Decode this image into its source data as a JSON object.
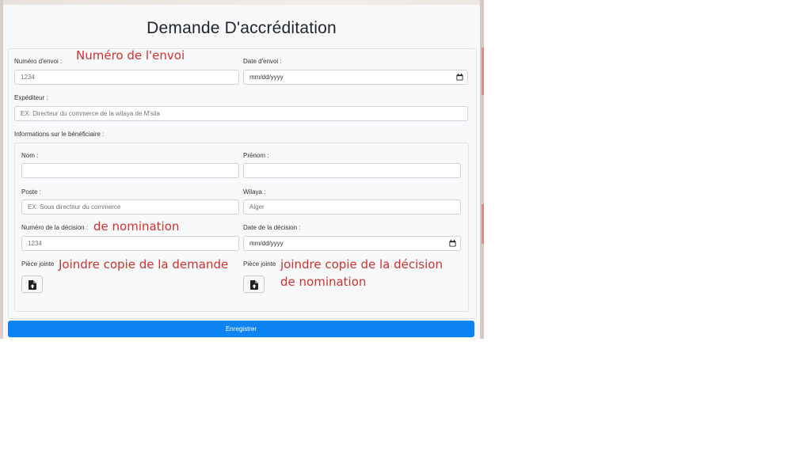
{
  "form": {
    "title": "Demande D'accréditation",
    "numero_envoi": {
      "label": "Numéro d'envoi :",
      "placeholder": "1234"
    },
    "date_envoi": {
      "label": "Date d'envoi :",
      "placeholder": "mm/dd/yyyy"
    },
    "expediteur": {
      "label": "Expéditeur :",
      "placeholder": "EX: Directeur du commerce de la wilaya de M'sila"
    },
    "beneficiaire_section_label": "Informations sur le bénéficiaire :",
    "nom": {
      "label": "Nom :",
      "value": ""
    },
    "prenom": {
      "label": "Prénom :",
      "value": ""
    },
    "poste": {
      "label": "Poste :",
      "placeholder": "EX: Sous directeur du commerce"
    },
    "wilaya": {
      "label": "Wilaya :",
      "placeholder": "Alger"
    },
    "numero_decision": {
      "label": "Numéro de la décision :",
      "placeholder": "1234"
    },
    "date_decision": {
      "label": "Date de la décision :",
      "placeholder": "mm/dd/yyyy"
    },
    "piece_jointe_1": {
      "label": "Pièce jointe"
    },
    "piece_jointe_2": {
      "label": "Pièce jointe"
    },
    "submit_label": "Enregistrer"
  },
  "annotations": {
    "numero_envoi": "Numéro de l'envoi",
    "nomination": "de nomination",
    "copie_demande": "Joindre copie de la demande",
    "copie_decision_line1": "joindre copie de la décision",
    "copie_decision_line2": "de nomination"
  },
  "colors": {
    "primary_button": "#0d84f3",
    "annotation_text": "#d0312d"
  },
  "icons": {
    "date_picker": "calendar-icon",
    "file_upload": "file-upload-icon"
  }
}
